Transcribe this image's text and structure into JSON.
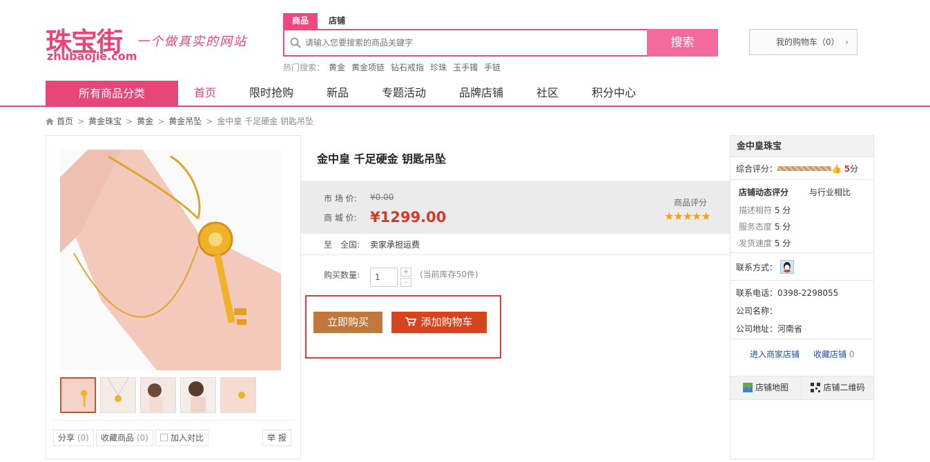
{
  "header": {
    "logo_cn": "珠宝街",
    "logo_en": "zhubaojie.com",
    "slogan": "一个做真实的网站",
    "search_tabs": [
      "商品",
      "店铺"
    ],
    "search_placeholder": "请输入您要搜索的商品关键字",
    "search_button": "搜索",
    "hot_label": "热门搜索：",
    "hot_terms": [
      "黄金",
      "黄金项链",
      "钻石戒指",
      "珍珠",
      "玉手镯",
      "手链"
    ],
    "cart_label": "我的购物车（0）",
    "cart_chevron": "›"
  },
  "nav": {
    "all_categories": "所有商品分类",
    "items": [
      "首页",
      "限时抢购",
      "新品",
      "专题活动",
      "品牌店铺",
      "社区",
      "积分中心"
    ]
  },
  "breadcrumb": {
    "items": [
      "首页",
      "黄金珠宝",
      "黄金",
      "黄金吊坠",
      "金中皇 千足硬金 钥匙吊坠"
    ],
    "separator": ">"
  },
  "gallery": {
    "share_label": "分享",
    "share_count": "(0)",
    "fav_label": "收藏商品",
    "fav_count": "(0)",
    "compare_label": "加入对比",
    "report_label": "举 报"
  },
  "product": {
    "title": "金中皇 千足硬金 钥匙吊坠",
    "market_price_label": "市 场 价:",
    "market_price": "¥0.00",
    "shop_price_label": "商 城 价:",
    "shop_price": "¥1299.00",
    "rating_label": "商品评分",
    "stars": "★★★★★",
    "ship_to_label": "至　全国:",
    "ship_note": "卖家承担运费",
    "qty_label": "购买数量:",
    "qty_value": "1",
    "qty_plus": "+",
    "qty_minus": "-",
    "stock_note": "(当前库存50件)",
    "buy_now": "立即购买",
    "add_to_cart": "添加购物车"
  },
  "shop": {
    "name": "金中皇珠宝",
    "overall_label": "综合评分：",
    "overall_score": "5",
    "overall_unit": "分",
    "dyn_label": "店铺动态评分",
    "compare_label": "与行业相比",
    "desc_label": "描述相符",
    "desc_score": "5 分",
    "service_label": "服务态度",
    "service_score": "5 分",
    "delivery_label": "发货速度",
    "delivery_score": "5 分",
    "contact_label": "联系方式：",
    "phone": "联系电话：0398-2298055",
    "company": "公司名称：",
    "address": "公司地址：河南省",
    "enter_shop": "进入商家店铺",
    "fav_shop": "收藏店铺",
    "fav_shop_count": "0",
    "map_tab": "店铺地图",
    "qr_tab": "店铺二维码"
  },
  "colors": {
    "brand_pink": "#e8457a",
    "price_red": "#d23a2a",
    "buy_brown": "#c1793b",
    "cart_orange": "#d6441d"
  }
}
